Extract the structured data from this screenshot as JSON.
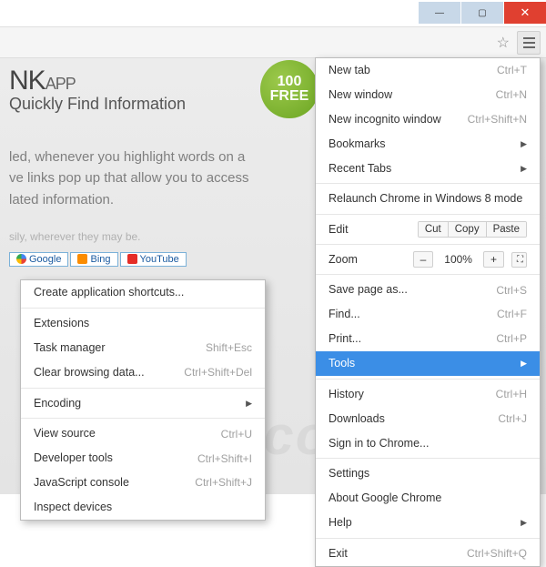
{
  "window": {
    "min": "—",
    "max": "▢",
    "close": "✕"
  },
  "hero": {
    "title_a": "NK",
    "title_b": "APP",
    "subtitle": "Quickly Find Information",
    "badge_top": "100",
    "badge_bot": "FREE",
    "desc1": "led, whenever you highlight words on a",
    "desc2": "ve links pop up that allow you to access",
    "desc3": "lated information.",
    "faint": "sily, wherever they may be.",
    "search": {
      "google": "Google",
      "bing": "Bing",
      "youtube": "YouTube"
    }
  },
  "mainmenu": {
    "newtab": {
      "label": "New tab",
      "sc": "Ctrl+T"
    },
    "newwin": {
      "label": "New window",
      "sc": "Ctrl+N"
    },
    "inco": {
      "label": "New incognito window",
      "sc": "Ctrl+Shift+N"
    },
    "bookmarks": {
      "label": "Bookmarks"
    },
    "recent": {
      "label": "Recent Tabs"
    },
    "relaunch": {
      "label": "Relaunch Chrome in Windows 8 mode"
    },
    "edit": {
      "label": "Edit",
      "cut": "Cut",
      "copy": "Copy",
      "paste": "Paste"
    },
    "zoom": {
      "label": "Zoom",
      "minus": "–",
      "value": "100%",
      "plus": "+",
      "fs": "⛶"
    },
    "save": {
      "label": "Save page as...",
      "sc": "Ctrl+S"
    },
    "find": {
      "label": "Find...",
      "sc": "Ctrl+F"
    },
    "print": {
      "label": "Print...",
      "sc": "Ctrl+P"
    },
    "tools": {
      "label": "Tools"
    },
    "history": {
      "label": "History",
      "sc": "Ctrl+H"
    },
    "downloads": {
      "label": "Downloads",
      "sc": "Ctrl+J"
    },
    "signin": {
      "label": "Sign in to Chrome..."
    },
    "settings": {
      "label": "Settings"
    },
    "about": {
      "label": "About Google Chrome"
    },
    "help": {
      "label": "Help"
    },
    "exit": {
      "label": "Exit",
      "sc": "Ctrl+Shift+Q"
    }
  },
  "submenu": {
    "shortcuts": {
      "label": "Create application shortcuts..."
    },
    "ext": {
      "label": "Extensions"
    },
    "taskmgr": {
      "label": "Task manager",
      "sc": "Shift+Esc"
    },
    "clear": {
      "label": "Clear browsing data...",
      "sc": "Ctrl+Shift+Del"
    },
    "encoding": {
      "label": "Encoding"
    },
    "vsource": {
      "label": "View source",
      "sc": "Ctrl+U"
    },
    "devtools": {
      "label": "Developer tools",
      "sc": "Ctrl+Shift+I"
    },
    "jscons": {
      "label": "JavaScript console",
      "sc": "Ctrl+Shift+J"
    },
    "inspect": {
      "label": "Inspect devices"
    }
  },
  "watermark": "isk.com"
}
